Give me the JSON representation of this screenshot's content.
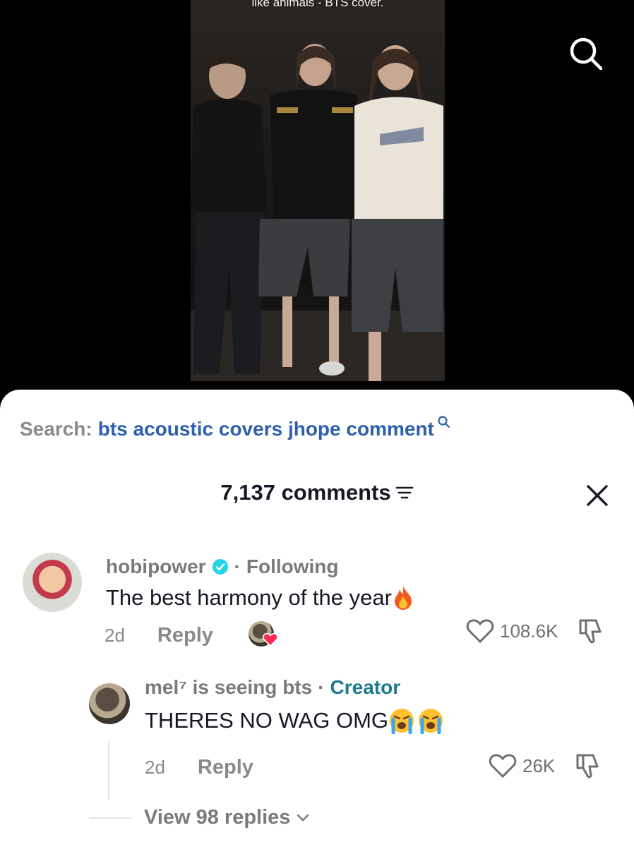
{
  "video": {
    "caption": "like animals - BTS cover."
  },
  "search": {
    "prefix": "Search:",
    "query": "bts acoustic covers jhope comment"
  },
  "header": {
    "comment_count": "7,137 comments"
  },
  "comments": [
    {
      "username": "hobipower",
      "relation": "Following",
      "text": "The best harmony of the year",
      "time": "2d",
      "reply_label": "Reply",
      "likes": "108.6K"
    },
    {
      "username": "mel⁷ is seeing bts",
      "relation": "Creator",
      "text": "THERES NO WAG OMG",
      "time": "2d",
      "reply_label": "Reply",
      "likes": "26K"
    }
  ],
  "replies": {
    "label": "View 98 replies"
  },
  "colors": {
    "link_blue": "#2d5fad",
    "creator_teal": "#1d7a8c",
    "verified_blue": "#20d5ec",
    "heart_pink": "#fe2c55"
  }
}
